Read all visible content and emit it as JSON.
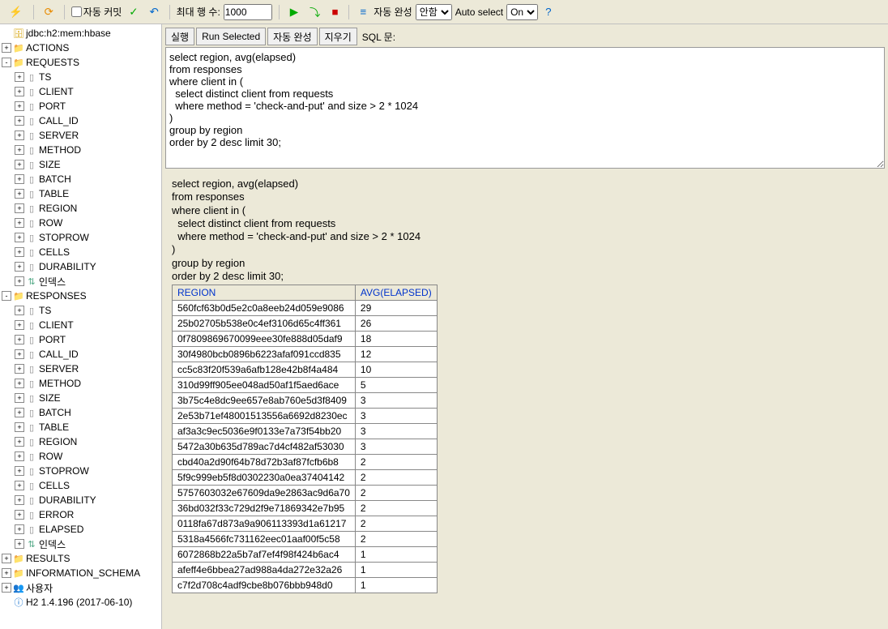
{
  "toolbar": {
    "autocommit_label": "자동 커밋",
    "maxrows_label": "최대 행 수:",
    "maxrows_value": 1000,
    "autocomplete_label": "자동 완성",
    "autocomplete_options": [
      "안함"
    ],
    "autocomplete_selected": "안함",
    "autoselect_label": "Auto select",
    "autoselect_options": [
      "On"
    ],
    "autoselect_selected": "On"
  },
  "sidebar": {
    "db": "jdbc:h2:mem:hbase",
    "nodes": [
      {
        "label": "ACTIONS",
        "icon": "📁",
        "expand": "+"
      },
      {
        "label": "REQUESTS",
        "icon": "📁",
        "expand": "-",
        "children": [
          "TS",
          "CLIENT",
          "PORT",
          "CALL_ID",
          "SERVER",
          "METHOD",
          "SIZE",
          "BATCH",
          "TABLE",
          "REGION",
          "ROW",
          "STOPROW",
          "CELLS",
          "DURABILITY"
        ],
        "index_label": "인덱스"
      },
      {
        "label": "RESPONSES",
        "icon": "📁",
        "expand": "-",
        "children": [
          "TS",
          "CLIENT",
          "PORT",
          "CALL_ID",
          "SERVER",
          "METHOD",
          "SIZE",
          "BATCH",
          "TABLE",
          "REGION",
          "ROW",
          "STOPROW",
          "CELLS",
          "DURABILITY",
          "ERROR",
          "ELAPSED"
        ],
        "index_label": "인덱스"
      },
      {
        "label": "RESULTS",
        "icon": "📁",
        "expand": "+"
      },
      {
        "label": "INFORMATION_SCHEMA",
        "icon": "📁",
        "cls": "folder-icon",
        "expand": "+"
      },
      {
        "label": "사용자",
        "icon": "👥",
        "expand": "+"
      }
    ],
    "version": "H2 1.4.196 (2017-06-10)"
  },
  "sql": {
    "run_label": "실행",
    "run_selected_label": "Run Selected",
    "autocomplete_label": "자동 완성",
    "clear_label": "지우기",
    "statement_label": "SQL 문:",
    "text": "select region, avg(elapsed)\nfrom responses\nwhere client in (\n  select distinct client from requests\n  where method = 'check-and-put' and size > 2 * 1024\n)\ngroup by region\norder by 2 desc limit 30;"
  },
  "result": {
    "echo": "select region, avg(elapsed)\nfrom responses\nwhere client in (\n  select distinct client from requests\n  where method = 'check-and-put' and size > 2 * 1024\n)\ngroup by region\norder by 2 desc limit 30;",
    "columns": [
      "REGION",
      "AVG(ELAPSED)"
    ],
    "rows": [
      [
        "560fcf63b0d5e2c0a8eeb24d059e9086",
        "29"
      ],
      [
        "25b02705b538e0c4ef3106d65c4ff361",
        "26"
      ],
      [
        "0f7809869670099eee30fe888d05daf9",
        "18"
      ],
      [
        "30f4980bcb0896b6223afaf091ccd835",
        "12"
      ],
      [
        "cc5c83f20f539a6afb128e42b8f4a484",
        "10"
      ],
      [
        "310d99ff905ee048ad50af1f5aed6ace",
        "5"
      ],
      [
        "3b75c4e8dc9ee657e8ab760e5d3f8409",
        "3"
      ],
      [
        "2e53b71ef48001513556a6692d8230ec",
        "3"
      ],
      [
        "af3a3c9ec5036e9f0133e7a73f54bb20",
        "3"
      ],
      [
        "5472a30b635d789ac7d4cf482af53030",
        "3"
      ],
      [
        "cbd40a2d90f64b78d72b3af87fcfb6b8",
        "2"
      ],
      [
        "5f9c999eb5f8d0302230a0ea37404142",
        "2"
      ],
      [
        "5757603032e67609da9e2863ac9d6a70",
        "2"
      ],
      [
        "36bd032f33c729d2f9e71869342e7b95",
        "2"
      ],
      [
        "0118fa67d873a9a906113393d1a61217",
        "2"
      ],
      [
        "5318a4566fc731162eec01aaf00f5c58",
        "2"
      ],
      [
        "6072868b22a5b7af7ef4f98f424b6ac4",
        "1"
      ],
      [
        "afeff4e6bbea27ad988a4da272e32a26",
        "1"
      ],
      [
        "c7f2d708c4adf9cbe8b076bbb948d0",
        "1"
      ]
    ]
  }
}
